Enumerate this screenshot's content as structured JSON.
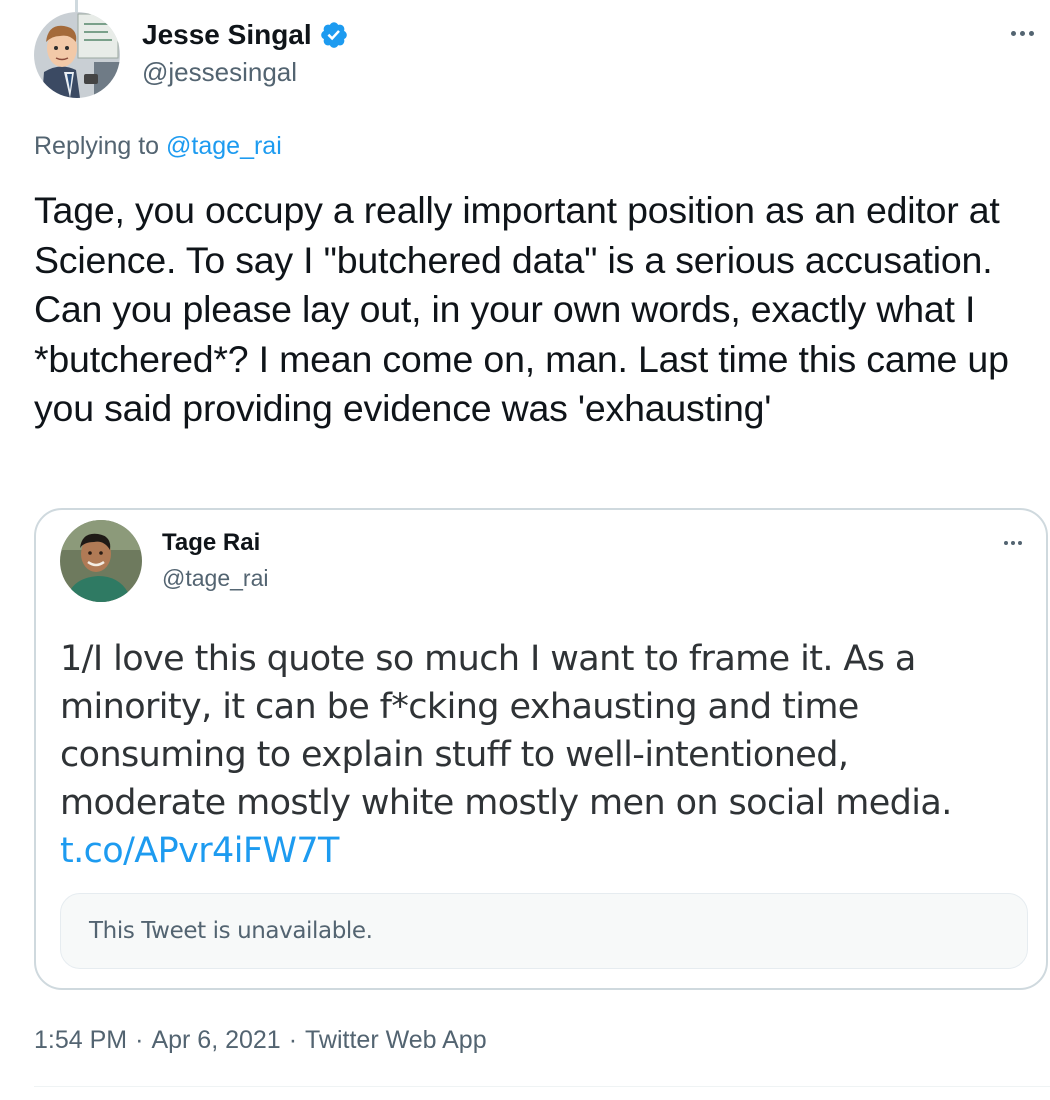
{
  "main_tweet": {
    "author": {
      "display_name": "Jesse Singal",
      "handle": "@jessesingal",
      "verified": true
    },
    "reply_context": {
      "prefix": "Replying to ",
      "handle": "@tage_rai"
    },
    "text": "Tage, you occupy a really important position as an editor at Science. To say I \"butchered data\" is a serious accusation. Can you please lay out, in your own words, exactly what I *butchered*? I mean come on, man. Last time this came up you said providing evidence was 'exhausting'",
    "timestamp": "1:54 PM",
    "date": "Apr 6, 2021",
    "source": "Twitter Web App",
    "separator": "·"
  },
  "quoted_tweet": {
    "author": {
      "display_name": "Tage Rai",
      "handle": "@tage_rai"
    },
    "text": "1/I love this quote so much I want to frame it. As a minority, it can be f*cking exhausting and time consuming to explain stuff to well-intentioned, moderate mostly white mostly men on social media.",
    "link": "t.co/APvr4iFW7T",
    "unavailable_notice": "This Tweet is unavailable."
  },
  "icons": {
    "verified": "verified-badge-icon",
    "more": "more-options-icon"
  },
  "colors": {
    "accent": "#1d9bf0",
    "secondary_text": "#536471",
    "primary_text": "#0f1419",
    "border": "#cfd9de"
  }
}
